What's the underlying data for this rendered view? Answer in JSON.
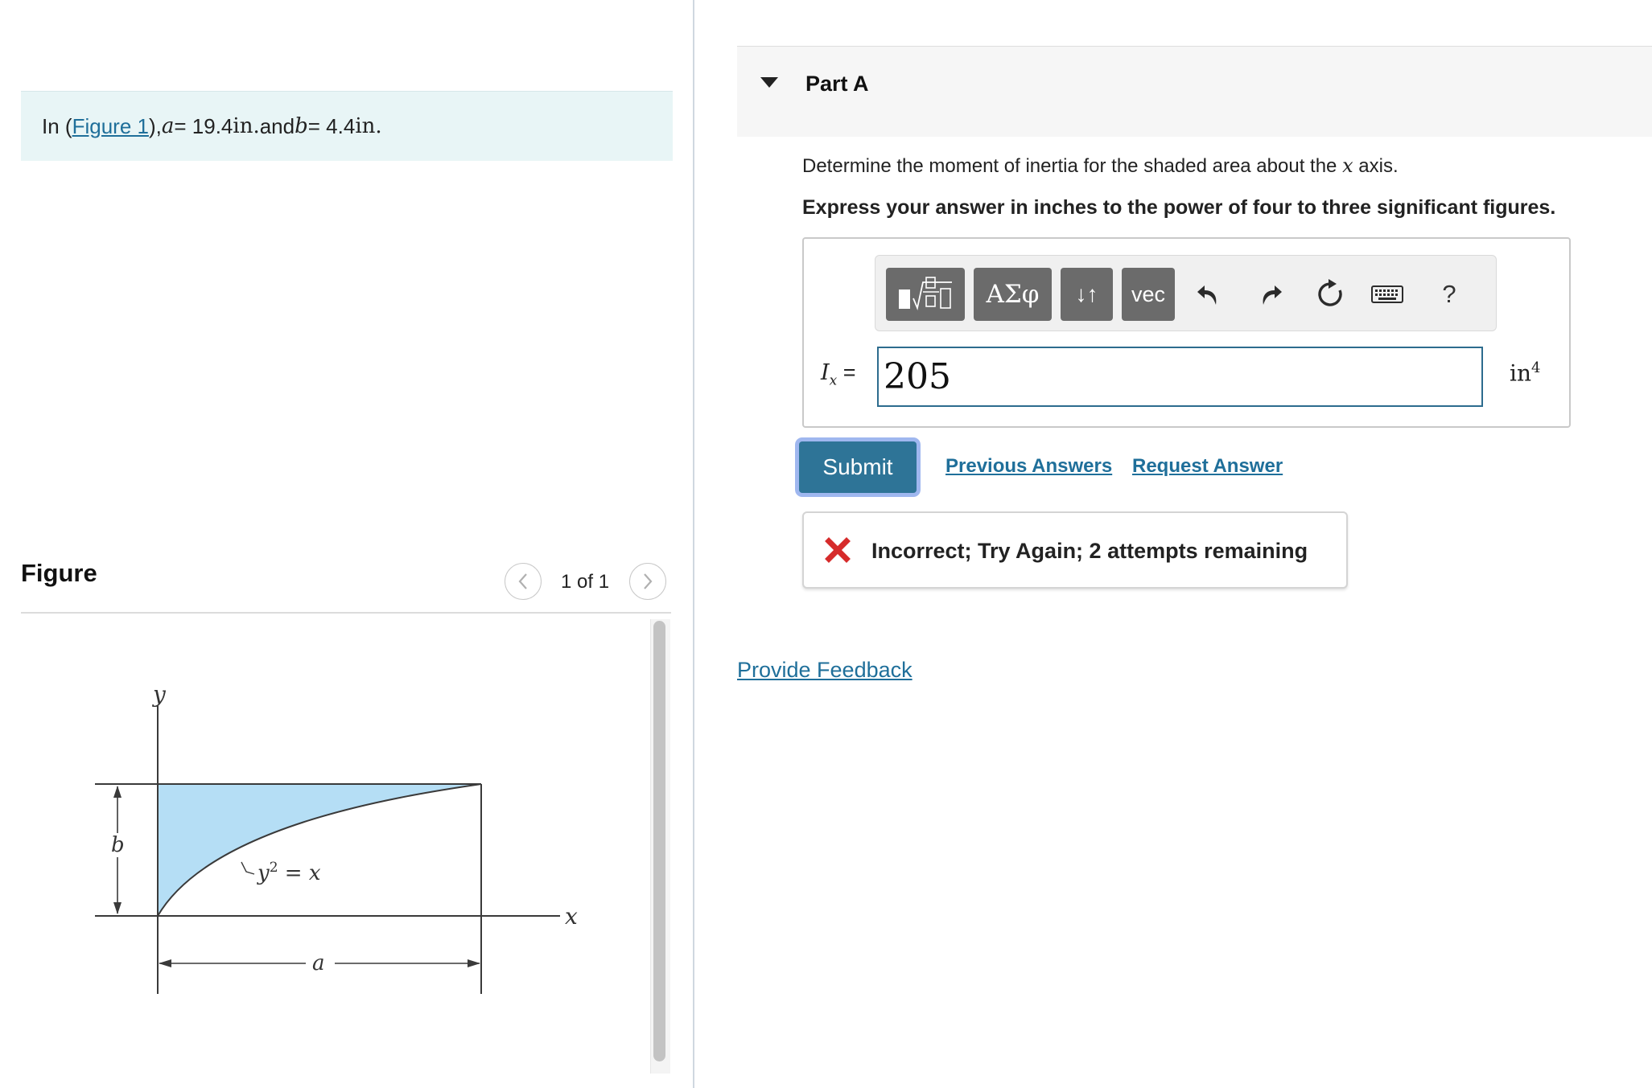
{
  "intro": {
    "prefix": "In (",
    "figure_link": "Figure 1",
    "suffix_1": "), ",
    "var_a": "a",
    "eq_a": " = 19.4 ",
    "unit_a": "in.",
    "and": " and ",
    "var_b": "b",
    "eq_b": " = 4.4 ",
    "unit_b": "in."
  },
  "figure_panel": {
    "title": "Figure",
    "counter": "1 of 1",
    "prev_icon": "chevron-left-icon",
    "next_icon": "chevron-right-icon",
    "labels": {
      "y_axis": "y",
      "x_axis": "x",
      "b": "b",
      "a": "a",
      "curve_y": "y",
      "curve_exp": "2",
      "curve_rest": " = x"
    },
    "fill_color": "#b5def5"
  },
  "part": {
    "title": "Part A",
    "caret_icon": "caret-down-icon",
    "question_prefix": "Determine the moment of inertia for the shaded area about the ",
    "question_var": "x",
    "question_suffix": " axis.",
    "instruction": "Express your answer in inches to the power of four to three significant figures."
  },
  "toolbar": {
    "greek_label": "ΑΣφ",
    "arrows_label": "↓↑",
    "vec_label": "vec",
    "help_label": "?",
    "icons": [
      "templates-icon",
      "undo-icon",
      "redo-icon",
      "reset-icon",
      "keyboard-icon"
    ]
  },
  "answer": {
    "label_var": "I",
    "label_sub": "x",
    "label_eq": " =",
    "value": "205",
    "units": "in",
    "units_exp": "4"
  },
  "actions": {
    "submit_label": "Submit",
    "previous_answers": "Previous Answers",
    "request_answer": "Request Answer"
  },
  "feedback": {
    "status": "incorrect",
    "message": "Incorrect; Try Again; 2 attempts remaining",
    "icon_color": "#d62b2b"
  },
  "provide_feedback": "Provide Feedback",
  "colors": {
    "link": "#1f6f9a",
    "submit_bg": "#2e7497",
    "intro_bg": "#e8f5f6",
    "toolbar_btn": "#6b6b6b"
  }
}
